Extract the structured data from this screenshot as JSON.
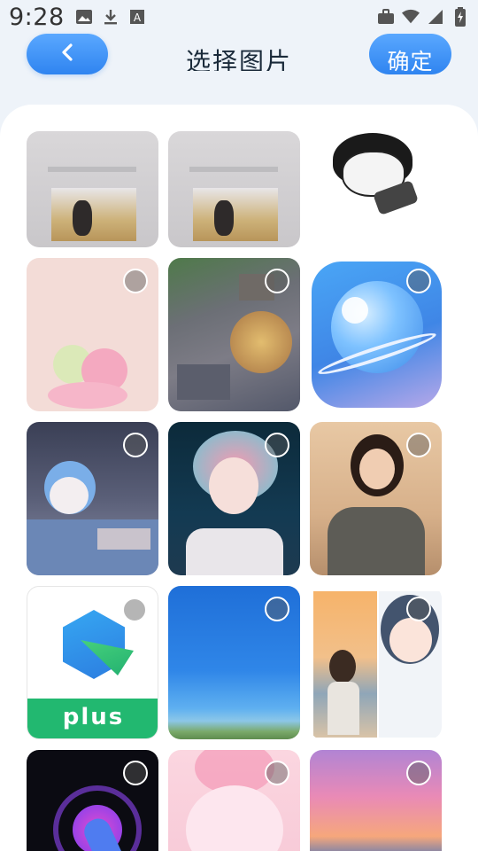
{
  "status_bar": {
    "time": "9:28",
    "left_icons": [
      "gallery-icon",
      "download-icon",
      "font-icon"
    ],
    "right_icons": [
      "briefcase-icon",
      "wifi-icon",
      "signal-icon",
      "battery-icon"
    ]
  },
  "header": {
    "back_icon": "chevron-left-icon",
    "title": "选择图片",
    "confirm_label": "确定"
  },
  "colors": {
    "accent": "#3b8ef5",
    "background": "#eef3f9",
    "panel": "#ffffff"
  },
  "photos": [
    {
      "name": "photo-1",
      "content": "instagram-screenshot-girl",
      "selectable": false
    },
    {
      "name": "photo-2",
      "content": "instagram-screenshot-girl",
      "selectable": false
    },
    {
      "name": "photo-3",
      "content": "meme-sticker",
      "selectable": false
    },
    {
      "name": "photo-4",
      "content": "kirby-pixel",
      "selectable": true
    },
    {
      "name": "photo-5",
      "content": "pixel-town",
      "selectable": true
    },
    {
      "name": "photo-6",
      "content": "planet-app-icon",
      "selectable": true
    },
    {
      "name": "photo-7",
      "content": "anime-boy",
      "selectable": true
    },
    {
      "name": "photo-8",
      "content": "anime-girl-pink-hair",
      "selectable": true
    },
    {
      "name": "photo-9",
      "content": "girl-portrait",
      "selectable": true
    },
    {
      "name": "photo-10",
      "content": "plus-app-icon",
      "selectable": true,
      "label": "plus"
    },
    {
      "name": "photo-11",
      "content": "blue-sky",
      "selectable": true
    },
    {
      "name": "photo-12",
      "content": "collage-girls",
      "selectable": true
    },
    {
      "name": "photo-13",
      "content": "dark-touch-icon",
      "selectable": true
    },
    {
      "name": "photo-14",
      "content": "pink-anime",
      "selectable": true
    },
    {
      "name": "photo-15",
      "content": "sunset-sea",
      "selectable": true
    }
  ]
}
